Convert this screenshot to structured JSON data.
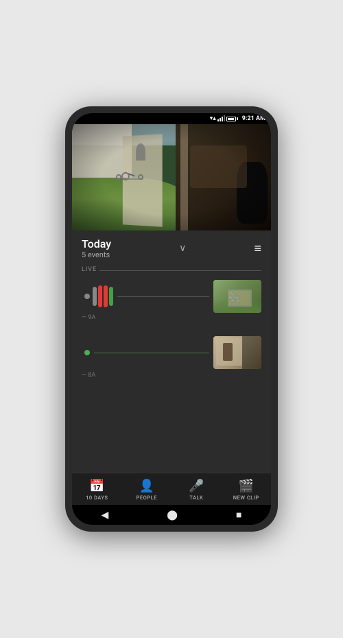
{
  "phone": {
    "status_bar": {
      "time": "9:21 AM",
      "wifi": "▼▲",
      "signal": "signal",
      "battery": "battery"
    },
    "camera": {
      "alt": "Security camera view of front yard"
    },
    "header": {
      "title": "Today",
      "subtitle": "5 events",
      "chevron": "∨",
      "menu_icon": "≡"
    },
    "timeline": {
      "live_label": "LIVE",
      "time_labels": [
        "9A",
        "8A"
      ],
      "event1": {
        "bar1_color": "#888",
        "bar2_color": "#e53935",
        "bar3_color": "#e53935",
        "bar4_color": "#43a047"
      },
      "event2": {
        "dot_color": "#43a047"
      }
    },
    "tabs": [
      {
        "id": "10days",
        "label": "10 DAYS",
        "icon": "📅"
      },
      {
        "id": "people",
        "label": "PEOPLE",
        "icon": "👤"
      },
      {
        "id": "talk",
        "label": "TALK",
        "icon": "🎤"
      },
      {
        "id": "newclip",
        "label": "NEW CLIP",
        "icon": "🎬"
      }
    ],
    "nav": {
      "back": "◀",
      "home": "⬤",
      "recents": "■"
    }
  }
}
